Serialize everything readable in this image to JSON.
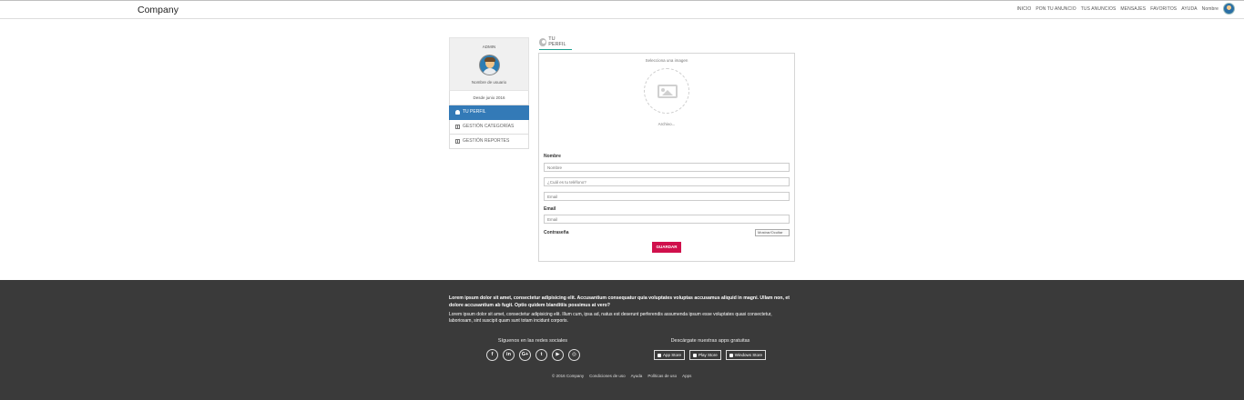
{
  "header": {
    "brand": "Company",
    "nav": [
      "INICIO",
      "PON TU ANUNCIO",
      "TUS ANUNCIOS",
      "MENSAJES",
      "FAVORITOS",
      "AYUDA",
      "Nombre"
    ]
  },
  "sidebar": {
    "role": "ADMIN",
    "username": "Nombre de usuario",
    "since": "Desde junio 2016",
    "items": [
      {
        "label": "TU PERFIL",
        "icon": "user-icon",
        "active": true
      },
      {
        "label": "GESTIÓN CATEGORÍAS",
        "icon": "grid-icon",
        "active": false
      },
      {
        "label": "GESTIÓN REPORTES",
        "icon": "grid-icon",
        "active": false
      }
    ]
  },
  "main": {
    "tab_label": "TU PERFIL",
    "select_image": "Selecciona una imagen",
    "file_label": "Archivo...",
    "name_label": "Nombre",
    "name_placeholder": "Nombre",
    "phone_placeholder": "¿Cuál es tu teléfono?",
    "email1_placeholder": "Email",
    "email_label": "Email",
    "email2_placeholder": "Email",
    "password_label": "Contraseña",
    "password_toggle": "Mostrar/Ocultar",
    "save_label": "GUARDAR"
  },
  "footer": {
    "bold_text": "Lorem ipsum dolor sit amet, consectetur adipisicing elit. Accusantium consequatur quia voluptates voluptas accusamus aliquid in magni. Ullam non, et dolore accusantium ab fugit. Optio quidem blanditiis possimus at vero?",
    "text": "Lorem ipsum dolor sit amet, consectetur adipisicing elit. Illum cum, ipsa ad, natus est deserunt perferendis assumenda ipsum esse voluptates quasi consectetur, laboriosam, sint suscipit quam sunt totam incidunt corporis.",
    "social_title": "Síguenos en las redes sociales",
    "social": [
      "f",
      "in",
      "G+",
      "t",
      "▶",
      "◎"
    ],
    "apps_title": "Descárgate nuestras apps gratuitas",
    "apps": [
      "App Store",
      "Play Store",
      "Windows Store"
    ],
    "links": [
      "© 2016 Company",
      "Condiciones de uso",
      "Ayuda",
      "Políticas de uso",
      "Apps"
    ]
  },
  "colors": {
    "accent": "#337ab7",
    "save": "#d0104c",
    "footer_bg": "#3a3a3a",
    "tab_underline": "#1aa090"
  }
}
